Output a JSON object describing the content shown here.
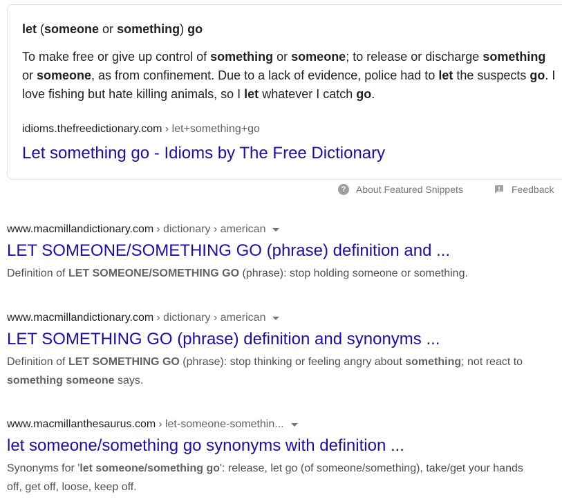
{
  "featured_snippet": {
    "heading_parts": [
      {
        "text": "let",
        "bold": true
      },
      {
        "text": " (",
        "bold": false
      },
      {
        "text": "someone",
        "bold": true
      },
      {
        "text": " or ",
        "bold": false
      },
      {
        "text": "something",
        "bold": true
      },
      {
        "text": ") ",
        "bold": false
      },
      {
        "text": "go",
        "bold": true
      }
    ],
    "body_parts": [
      {
        "text": "To make free or give up control of ",
        "bold": false
      },
      {
        "text": "something",
        "bold": true
      },
      {
        "text": " or ",
        "bold": false
      },
      {
        "text": "someone",
        "bold": true
      },
      {
        "text": "; to release or discharge ",
        "bold": false
      },
      {
        "text": "something",
        "bold": true
      },
      {
        "text": " or ",
        "bold": false
      },
      {
        "text": "someone",
        "bold": true
      },
      {
        "text": ", as from confinement. Due to a lack of evidence, police had to ",
        "bold": false
      },
      {
        "text": "let",
        "bold": true
      },
      {
        "text": " the suspects ",
        "bold": false
      },
      {
        "text": "go",
        "bold": true
      },
      {
        "text": ". I love fishing but hate killing animals, so I ",
        "bold": false
      },
      {
        "text": "let",
        "bold": true
      },
      {
        "text": " whatever I catch ",
        "bold": false
      },
      {
        "text": "go",
        "bold": true
      },
      {
        "text": ".",
        "bold": false
      }
    ],
    "source_domain": "idioms.thefreedictionary.com",
    "source_path": "› let+something+go",
    "link_title": "Let something go - Idioms by The Free Dictionary"
  },
  "snippet_footer": {
    "about_label": "About Featured Snippets",
    "feedback_label": "Feedback",
    "about_icon": "help-icon",
    "feedback_icon": "feedback-flag-icon"
  },
  "results": [
    {
      "domain": "www.macmillandictionary.com",
      "path": "› dictionary › american",
      "title": "LET SOMEONE/SOMETHING GO (phrase) definition and ...",
      "snippet_parts": [
        {
          "text": "Definition of ",
          "bold": false
        },
        {
          "text": "LET SOMEONE/SOMETHING GO",
          "bold": true
        },
        {
          "text": " (phrase): stop holding someone or something.",
          "bold": false
        }
      ]
    },
    {
      "domain": "www.macmillandictionary.com",
      "path": "› dictionary › american",
      "title": "LET SOMETHING GO (phrase) definition and synonyms ...",
      "snippet_parts": [
        {
          "text": "Definition of ",
          "bold": false
        },
        {
          "text": "LET SOMETHING GO",
          "bold": true
        },
        {
          "text": " (phrase): stop thinking or feeling angry about ",
          "bold": false
        },
        {
          "text": "something",
          "bold": true
        },
        {
          "text": "; not react to ",
          "bold": false
        },
        {
          "text": "something someone",
          "bold": true
        },
        {
          "text": " says.",
          "bold": false
        }
      ]
    },
    {
      "domain": "www.macmillanthesaurus.com",
      "path": "› let-someone-somethin...",
      "title": "let someone/something go synonyms with definition ...",
      "snippet_parts": [
        {
          "text": "Synonyms for '",
          "bold": false
        },
        {
          "text": "let someone/something go",
          "bold": true
        },
        {
          "text": "': release, let go (of someone/something), take/get your hands off, get off, loose, keep off.",
          "bold": false
        }
      ]
    }
  ],
  "colors": {
    "link": "#1a0dab",
    "text": "#202124",
    "muted": "#4d5156",
    "border": "#dfe1e5"
  }
}
